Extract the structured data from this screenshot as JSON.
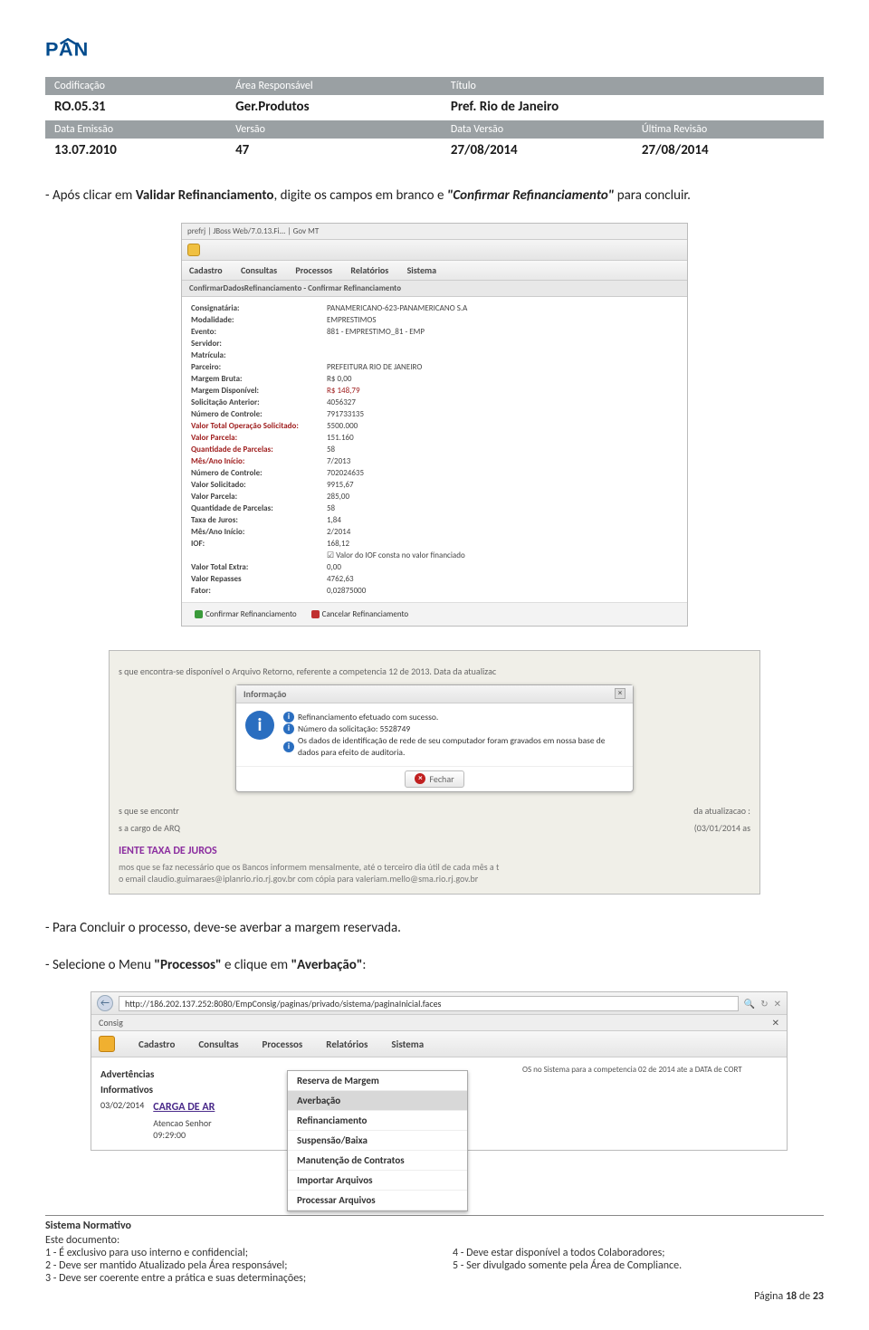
{
  "logo_text": "PAN",
  "header": {
    "labels": {
      "cod": "Codificação",
      "area": "Área Responsável",
      "titulo": "Título"
    },
    "values": {
      "cod": "RO.05.31",
      "area": "Ger.Produtos",
      "titulo": "Pref. Rio de Janeiro"
    },
    "labels2": {
      "emissao": "Data Emissão",
      "versao": "Versão",
      "dataversao": "Data Versão",
      "revisao": "Última Revisão"
    },
    "values2": {
      "emissao": "13.07.2010",
      "versao": "47",
      "dataversao": "27/08/2014",
      "revisao": "27/08/2014"
    }
  },
  "para1_pre": "- Após clicar em ",
  "para1_b1": "Validar Refinanciamento",
  "para1_mid": ", digite os campos em branco e ",
  "para1_b2": "\"Confirmar Refinanciamento\"",
  "para1_post": " para concluir.",
  "ss1": {
    "tabs": "prefrj   |   JBoss Web/7.0.13.Fi...   |   Gov MT",
    "menu": [
      "Cadastro",
      "Consultas",
      "Processos",
      "Relatórios",
      "Sistema"
    ],
    "crumb": "ConfirmarDadosRefinanciamento - Confirmar Refinanciamento",
    "rows": [
      {
        "l": "Consignatária:",
        "v": "PANAMERICANO-623-PANAMERICANO S.A"
      },
      {
        "l": "Modalidade:",
        "v": "EMPRESTIMOS"
      },
      {
        "l": "Evento:",
        "v": "881 - EMPRESTIMO_81 - EMP"
      },
      {
        "l": "Servidor:",
        "v": ""
      },
      {
        "l": "Matrícula:",
        "v": ""
      },
      {
        "l": "Parceiro:",
        "v": "PREFEITURA RIO DE JANEIRO"
      },
      {
        "l": "Margem Bruta:",
        "v": "R$ 0,00"
      },
      {
        "l": "Margem Disponível:",
        "v": "R$ 148,79",
        "lred": false,
        "vred": true
      },
      {
        "l": "Solicitação Anterior:",
        "v": "4056327"
      },
      {
        "l": "Número de Controle:",
        "v": "791733135"
      },
      {
        "l": "Valor Total Operação Solicitado:",
        "v": "5500.000",
        "lred": true
      },
      {
        "l": "Valor Parcela:",
        "v": "151.160",
        "lred": true
      },
      {
        "l": "Quantidade de Parcelas:",
        "v": "58",
        "lred": true
      },
      {
        "l": "Mês/Ano Início:",
        "v": "7/2013",
        "lred": true
      },
      {
        "l": "Número de Controle:",
        "v": "702024635"
      },
      {
        "l": "Valor Solicitado:",
        "v": "9915,67"
      },
      {
        "l": "Valor Parcela:",
        "v": "285,00"
      },
      {
        "l": "Quantidade de Parcelas:",
        "v": "58"
      },
      {
        "l": "Taxa de Juros:",
        "v": "1,84"
      },
      {
        "l": "Mês/Ano Início:",
        "v": "2/2014"
      },
      {
        "l": "IOF:",
        "v": "168,12"
      },
      {
        "l": "",
        "v": "☑  Valor do IOF consta no valor financiado"
      },
      {
        "l": "Valor Total Extra:",
        "v": "0,00"
      },
      {
        "l": "Valor Repasses",
        "v": "4762,63"
      },
      {
        "l": "Fator:",
        "v": "0,02875000"
      }
    ],
    "btn_confirm": "Confirmar Refinanciamento",
    "btn_cancel": "Cancelar Refinanciamento"
  },
  "ss2": {
    "bg_line1": "s que encontra-se disponível o Arquivo Retorno, referente a competencia 12 de 2013. Data da atualizac",
    "bg_line2": "s que se encontr",
    "bg_line3": "s a cargo de ARQ",
    "bg_right": "da atualizacao :",
    "bg_date": "(03/01/2014 as",
    "dialog_title": "Informação",
    "info1": "Refinanciamento efetuado com sucesso.",
    "info2": "Número da solicitação: 5528749",
    "info3": "Os dados de identificação de rede de seu computador foram gravados em nossa base de dados para efeito de auditoria.",
    "btn_close": "Fechar",
    "headline": "IENTE TAXA DE JUROS",
    "sub": "mos que se faz necessário que os Bancos informem mensalmente, até o terceiro dia útil de cada mês a t\no email claudio.guimaraes@iplanrio.rio.rj.gov.br com cópia para valeriam.mello@sma.rio.rj.gov.br"
  },
  "para2": "- Para Concluir o processo, deve-se averbar a margem reservada.",
  "para3_pre": "- Selecione o Menu ",
  "para3_b1": "\"Processos\"",
  "para3_mid": " e clique em ",
  "para3_b2": "\"Averbação\"",
  "para3_post": ":",
  "ss3": {
    "url": "http://186.202.137.252:8080/EmpConsig/paginas/privado/sistema/paginaInicial.faces",
    "tab": "Consig",
    "menu": [
      "Cadastro",
      "Consultas",
      "Processos",
      "Relatórios",
      "Sistema"
    ],
    "dropdown": [
      {
        "t": "Reserva de Margem",
        "hi": false
      },
      {
        "t": "Averbação",
        "hi": true
      },
      {
        "t": "Refinanciamento",
        "hi": false
      },
      {
        "t": "Suspensão/Baixa",
        "hi": false
      },
      {
        "t": "Manutenção de Contratos",
        "hi": false
      },
      {
        "t": "Importar Arquivos",
        "hi": false
      },
      {
        "t": "Processar Arquivos",
        "hi": false
      }
    ],
    "left_sec1": "Advertências",
    "left_sec2": "Informativos",
    "left_date": "03/02/2014",
    "left_link": "CARGA DE AR",
    "left_row": "Atencao Senhor\n09:29:00",
    "right_txt": "OS no Sistema para a competencia 02 de 2014 ate a DATA de CORT"
  },
  "footer": {
    "title": "Sistema Normativo",
    "sub": "Este documento:",
    "left": [
      "1 - É exclusivo para uso interno e confidencial;",
      "2 - Deve ser mantido Atualizado pela Área responsável;",
      "3 - Deve ser coerente entre a prática e suas determinações;"
    ],
    "right": [
      "4 - Deve estar disponível a todos Colaboradores;",
      "5 - Ser divulgado somente pela Área de Compliance."
    ],
    "page_pre": "Página ",
    "page_no": "18",
    "page_mid": " de ",
    "page_total": "23"
  }
}
